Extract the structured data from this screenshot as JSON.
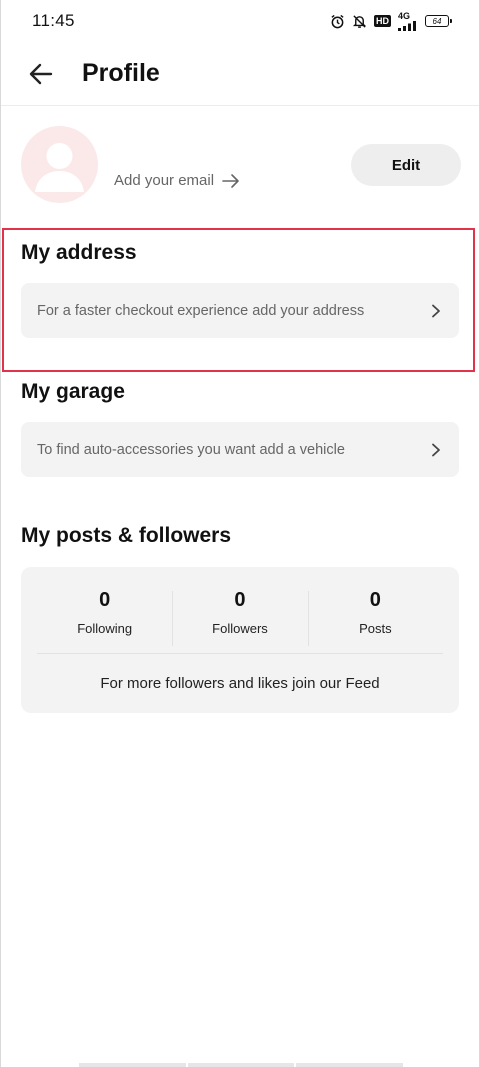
{
  "status_bar": {
    "time": "11:45",
    "hd": "HD",
    "network": "4G",
    "battery": "64",
    "icons": [
      "alarm-icon",
      "mute-icon",
      "hd-icon",
      "signal-icon",
      "battery-icon"
    ]
  },
  "header": {
    "title": "Profile",
    "back_icon": "arrow-left-icon"
  },
  "profile": {
    "add_email": "Add your email",
    "edit_label": "Edit",
    "avatar_color": "#fbe9ea"
  },
  "address": {
    "title": "My address",
    "row_text": "For a faster checkout experience add your address"
  },
  "garage": {
    "title": "My garage",
    "row_text": "To find auto-accessories you want add a vehicle"
  },
  "posts": {
    "title": "My posts & followers",
    "stats": [
      {
        "value": "0",
        "label": "Following"
      },
      {
        "value": "0",
        "label": "Followers"
      },
      {
        "value": "0",
        "label": "Posts"
      }
    ],
    "note": "For more followers and likes join our Feed"
  },
  "colors": {
    "highlight": "#e0344a",
    "card_bg": "#f3f3f3",
    "button_bg": "#eeeeee"
  }
}
